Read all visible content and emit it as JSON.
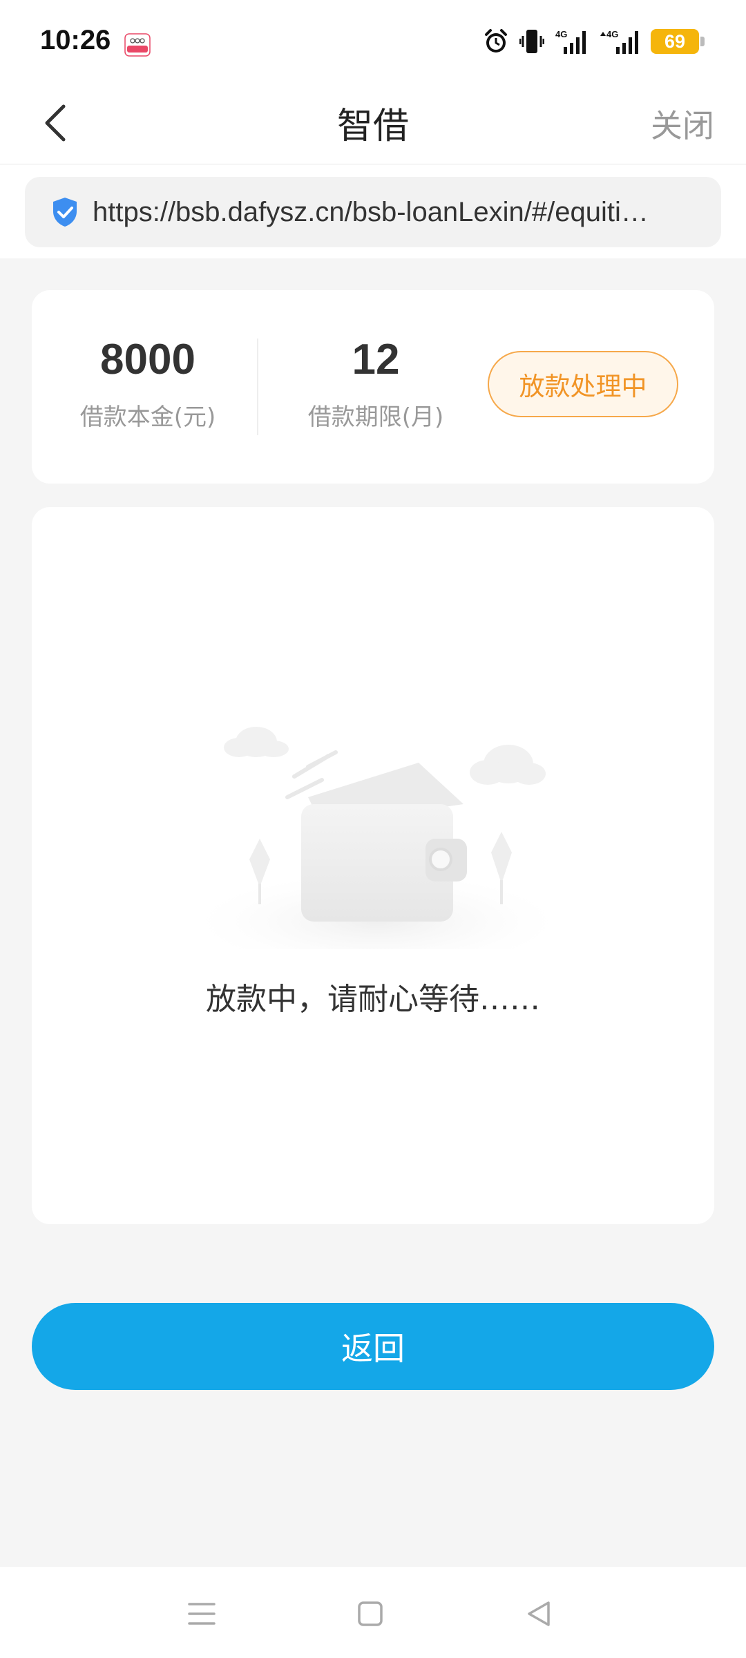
{
  "status_bar": {
    "time": "10:26",
    "battery": "69",
    "icons": [
      "oppo-app-icon",
      "alarm-icon",
      "vibrate-icon",
      "signal-4g-icon",
      "signal-4g-icon",
      "battery-icon"
    ],
    "network_label_1": "4G",
    "network_label_2": "4G",
    "battery_color": "#f5b50b"
  },
  "nav": {
    "title": "智借",
    "close_label": "关闭",
    "back_icon": "chevron-left-icon"
  },
  "url_bar": {
    "url": "https://bsb.dafysz.cn/bsb-loanLexin/#/equiti…",
    "secure_icon": "shield-check-icon",
    "shield_color": "#3d8ef0"
  },
  "summary": {
    "principal_value": "8000",
    "principal_label": "借款本金(元)",
    "term_value": "12",
    "term_label": "借款期限(月)",
    "status_badge": "放款处理中",
    "badge_color": "#f19426"
  },
  "status_card": {
    "illustration": "wallet-illustration",
    "message": "放款中，请耐心等待……"
  },
  "actions": {
    "return_label": "返回",
    "return_color": "#14a7e8"
  },
  "system_nav": {
    "icons": [
      "menu-icon",
      "home-icon",
      "back-triangle-icon"
    ]
  }
}
